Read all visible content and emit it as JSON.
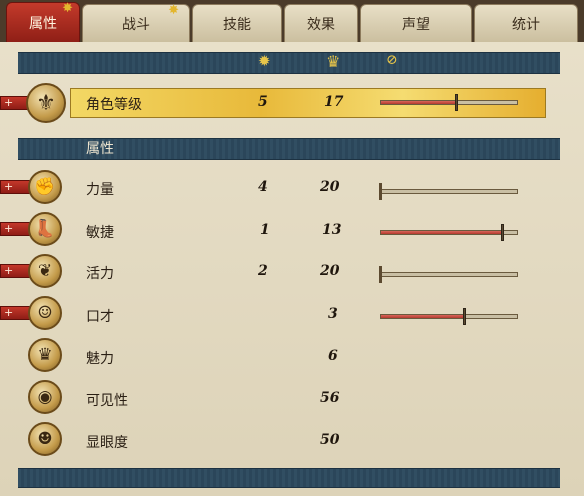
{
  "tabs": [
    {
      "label": "属性",
      "active": true,
      "star": true
    },
    {
      "label": "战斗",
      "active": false,
      "star": true
    },
    {
      "label": "技能",
      "active": false,
      "star": false
    },
    {
      "label": "效果",
      "active": false,
      "star": false
    },
    {
      "label": "声望",
      "active": false,
      "star": false
    },
    {
      "label": "统计",
      "active": false,
      "star": false
    }
  ],
  "header_icons": [
    "star-icon",
    "crown-icon",
    "progress-icon"
  ],
  "level_row": {
    "label": "角色等级",
    "points": "5",
    "value": "17",
    "progress": 0.55
  },
  "section_title": "属性",
  "attributes": [
    {
      "label": "力量",
      "points": "4",
      "value": "20",
      "progress": 0.0,
      "icon": "fist-icon",
      "plus": true
    },
    {
      "label": "敏捷",
      "points": "1",
      "value": "13",
      "progress": 0.88,
      "icon": "boot-icon",
      "plus": true
    },
    {
      "label": "活力",
      "points": "2",
      "value": "20",
      "progress": 0.0,
      "icon": "heart-arm-icon",
      "plus": true
    },
    {
      "label": "口才",
      "points": "",
      "value": "3",
      "progress": 0.6,
      "icon": "face-icon",
      "plus": true
    },
    {
      "label": "魅力",
      "points": "",
      "value": "6",
      "icon": "crown-icon",
      "plus": false
    },
    {
      "label": "可见性",
      "points": "",
      "value": "56",
      "icon": "eye-icon",
      "plus": false
    },
    {
      "label": "显眼度",
      "points": "",
      "value": "50",
      "icon": "mask-icon",
      "plus": false
    }
  ],
  "colors": {
    "accent_red": "#b43a2e",
    "strip_blue": "#2f4b5f",
    "gold": "#e8b93a"
  }
}
